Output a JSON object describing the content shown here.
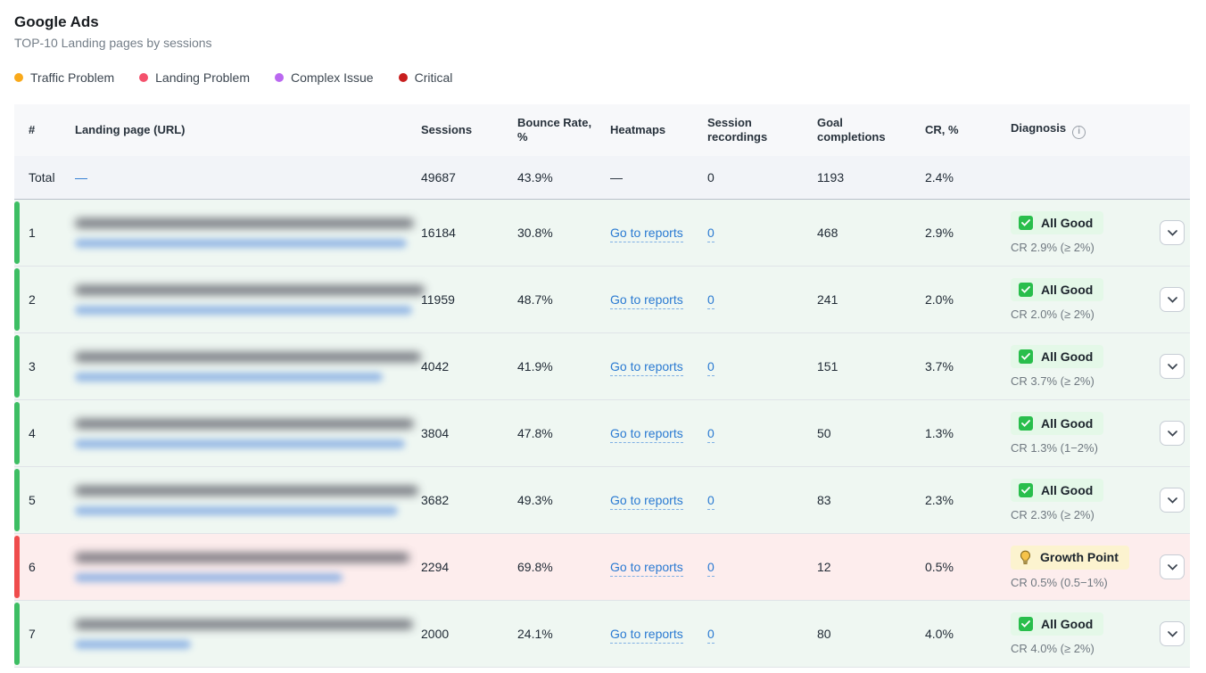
{
  "header": {
    "title": "Google Ads",
    "subtitle": "TOP-10 Landing pages by sessions"
  },
  "legend": [
    {
      "label": "Traffic Problem",
      "color": "#F9A91A"
    },
    {
      "label": "Landing Problem",
      "color": "#F4516C"
    },
    {
      "label": "Complex Issue",
      "color": "#BA68F0"
    },
    {
      "label": "Critical",
      "color": "#C81E1E"
    }
  ],
  "colors": {
    "link_blue": "#2A7AD2",
    "row_good_bg": "#EFF7F2",
    "row_good_bar": "#3DBE63",
    "row_warn_bg": "#FDEDED",
    "row_warn_bar": "#EF4C4C",
    "badge_good_bg": "#E4F8E8",
    "badge_warn_bg": "#FCF3CF",
    "check_green": "#29BE4C",
    "bulb_amber": "#F2B33D"
  },
  "table": {
    "columns": [
      "#",
      "Landing page (URL)",
      "Sessions",
      "Bounce Rate, %",
      "Heatmaps",
      "Session recordings",
      "Goal completions",
      "CR, %",
      "Diagnosis"
    ],
    "links": {
      "heatmaps": "Go to reports",
      "recordings": "0"
    },
    "total": {
      "label": "Total",
      "url": "—",
      "sessions": "49687",
      "bounce": "43.9%",
      "heatmaps": "—",
      "recordings": "0",
      "goals": "1193",
      "cr": "2.4%"
    },
    "rows": [
      {
        "num": "1",
        "sessions": "16184",
        "bounce": "30.8%",
        "goals": "468",
        "cr": "2.9%",
        "status": "good",
        "diagnosis": "All Good",
        "note": "CR 2.9% (≥ 2%)"
      },
      {
        "num": "2",
        "sessions": "11959",
        "bounce": "48.7%",
        "goals": "241",
        "cr": "2.0%",
        "status": "good",
        "diagnosis": "All Good",
        "note": "CR 2.0% (≥ 2%)"
      },
      {
        "num": "3",
        "sessions": "4042",
        "bounce": "41.9%",
        "goals": "151",
        "cr": "3.7%",
        "status": "good",
        "diagnosis": "All Good",
        "note": "CR 3.7% (≥ 2%)"
      },
      {
        "num": "4",
        "sessions": "3804",
        "bounce": "47.8%",
        "goals": "50",
        "cr": "1.3%",
        "status": "good",
        "diagnosis": "All Good",
        "note": "CR 1.3% (1−2%)"
      },
      {
        "num": "5",
        "sessions": "3682",
        "bounce": "49.3%",
        "goals": "83",
        "cr": "2.3%",
        "status": "good",
        "diagnosis": "All Good",
        "note": "CR 2.3% (≥ 2%)"
      },
      {
        "num": "6",
        "sessions": "2294",
        "bounce": "69.8%",
        "goals": "12",
        "cr": "0.5%",
        "status": "warn",
        "diagnosis": "Growth Point",
        "note": "CR 0.5% (0.5−1%)"
      },
      {
        "num": "7",
        "sessions": "2000",
        "bounce": "24.1%",
        "goals": "80",
        "cr": "4.0%",
        "status": "good",
        "diagnosis": "All Good",
        "note": "CR 4.0% (≥ 2%)"
      }
    ]
  }
}
